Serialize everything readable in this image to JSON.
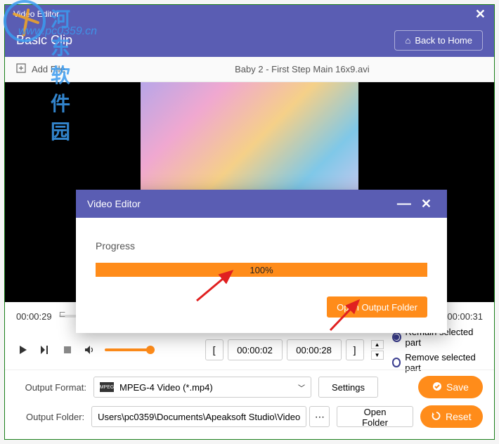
{
  "titlebar": {
    "title": "Video Editor",
    "close": "✕"
  },
  "header": {
    "title": "Basic Clip",
    "back_home": "Back to Home"
  },
  "toolbar": {
    "add_file": "Add File",
    "current_file": "Baby 2 - First Step Main 16x9.avi"
  },
  "timeline": {
    "start": "00:00:29",
    "end": "00:00:31"
  },
  "trim": {
    "left_bracket": "[",
    "start_time": "00:00:02",
    "end_time": "00:00:28",
    "right_bracket": "]"
  },
  "radios": {
    "remain": "Remain selected part",
    "remove": "Remove selected part"
  },
  "output": {
    "format_label": "Output Format:",
    "format_value": "MPEG-4 Video (*.mp4)",
    "format_badge": "MPEG",
    "settings": "Settings",
    "folder_label": "Output Folder:",
    "folder_value": "Users\\pc0359\\Documents\\Apeaksoft Studio\\Video",
    "open_folder": "Open Folder",
    "save": "Save",
    "reset": "Reset"
  },
  "modal": {
    "title": "Video Editor",
    "progress_label": "Progress",
    "progress_value": "100%",
    "open_output": "Open Output Folder"
  },
  "watermark": {
    "text1": "河东软件园",
    "text2": "www.pc0359.cn"
  }
}
